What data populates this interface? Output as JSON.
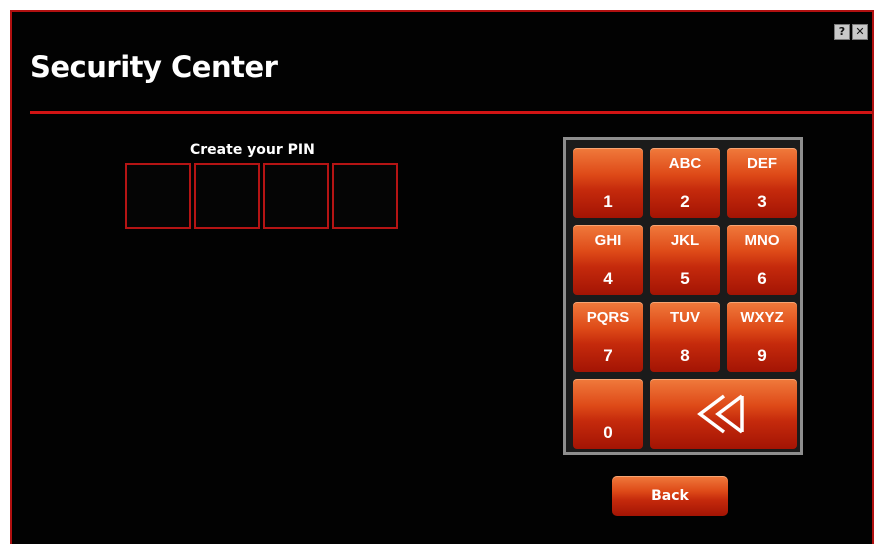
{
  "window": {
    "title": "Security Center",
    "controls": [
      {
        "glyph": "?",
        "icon": "help-icon"
      },
      {
        "glyph": "✕",
        "icon": "close-icon"
      }
    ]
  },
  "pin": {
    "label": "Create your PIN",
    "length": 4,
    "entered": ""
  },
  "keypad": {
    "keys": [
      {
        "letters": "",
        "digit": "1"
      },
      {
        "letters": "ABC",
        "digit": "2"
      },
      {
        "letters": "DEF",
        "digit": "3"
      },
      {
        "letters": "GHI",
        "digit": "4"
      },
      {
        "letters": "JKL",
        "digit": "5"
      },
      {
        "letters": "MNO",
        "digit": "6"
      },
      {
        "letters": "PQRS",
        "digit": "7"
      },
      {
        "letters": "TUV",
        "digit": "8"
      },
      {
        "letters": "WXYZ",
        "digit": "9"
      },
      {
        "letters": "",
        "digit": "0"
      }
    ],
    "backspace_icon": "backspace-double-arrow-icon"
  },
  "back_button": {
    "label": "Back"
  },
  "colors": {
    "background": "#020202",
    "accent_red": "#d11414",
    "key_orange": "#de4a18",
    "keypad_frame": "#8e8e8e"
  }
}
